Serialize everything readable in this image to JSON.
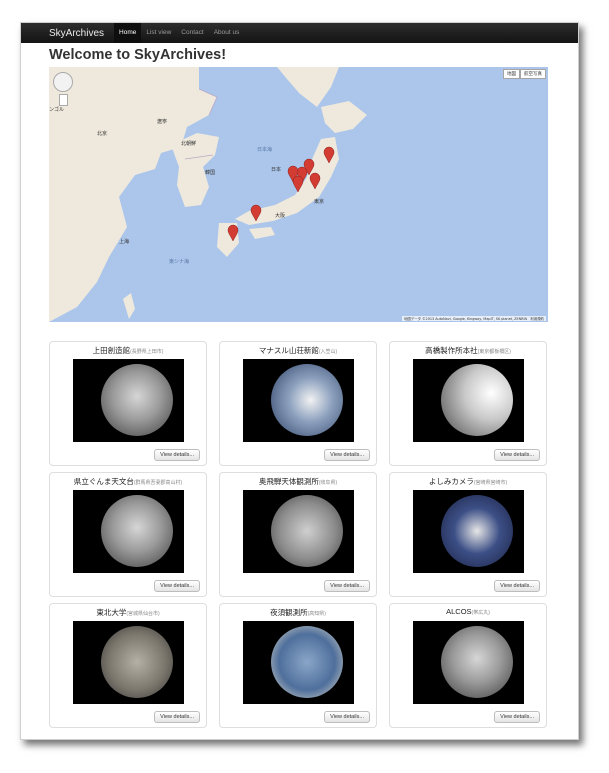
{
  "navbar": {
    "brand": "SkyArchives",
    "links": [
      {
        "label": "Home",
        "active": true
      },
      {
        "label": "List view",
        "active": false
      },
      {
        "label": "Contact",
        "active": false
      },
      {
        "label": "About us",
        "active": false
      }
    ]
  },
  "page": {
    "title": "Welcome to SkyArchives!"
  },
  "map": {
    "map_type_buttons": [
      "地図",
      "航空写真"
    ],
    "attribution": "地図データ ©2013 AutoNavi, Google, Kingway, MapIT, SK planet, ZENRIN　利用規約",
    "labels": {
      "japan": "日本",
      "korea": "韓国",
      "north_korea": "北朝鮮",
      "sea_of_japan": "日本海",
      "east_china_sea": "東シナ海",
      "tokyo": "東京",
      "osaka": "大阪",
      "shanghai": "上海",
      "beijing": "北京",
      "liaoning": "遼寧",
      "mongolia": "ンゴル"
    },
    "marker_count": 8,
    "colors": {
      "water": "#abc6ea",
      "land": "#efe9dd",
      "marker": "#d23c33"
    }
  },
  "cards": [
    {
      "title": "上田創造館",
      "location": "(長野県上田市)",
      "button": "View details...",
      "sky": "cloudy"
    },
    {
      "title": "マナスル山荘新館",
      "location": "(入笠山)",
      "button": "View details...",
      "sky": "partly"
    },
    {
      "title": "高橋製作所本社",
      "location": "(東京都板橋区)",
      "button": "View details...",
      "sky": "bright"
    },
    {
      "title": "県立ぐんま天文台",
      "location": "(群馬県吾妻郡高山村)",
      "button": "View details...",
      "sky": "cloudy"
    },
    {
      "title": "奥飛騨天体観測所",
      "location": "(岐阜県)",
      "button": "View details...",
      "sky": "gray"
    },
    {
      "title": "よしみカメラ",
      "location": "(宮崎県宮崎市)",
      "button": "View details...",
      "sky": "blue"
    },
    {
      "title": "東北大学",
      "location": "(宮城県仙台市)",
      "button": "View details...",
      "sky": "overcast"
    },
    {
      "title": "夜須観測所",
      "location": "(高知県)",
      "button": "View details...",
      "sky": "clear"
    },
    {
      "title": "ALCOS",
      "location": "(帯広丸)",
      "button": "View details...",
      "sky": "cloudy"
    }
  ]
}
